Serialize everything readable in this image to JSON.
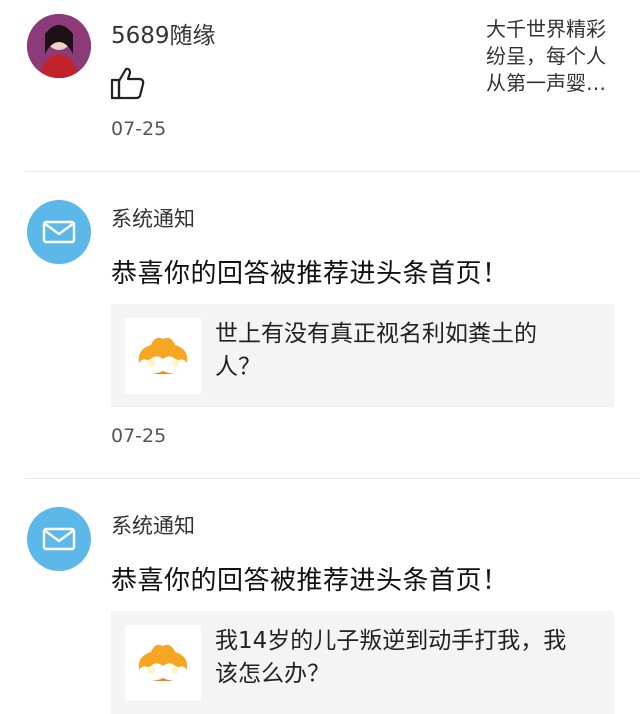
{
  "item1": {
    "username": "5689随缘",
    "snippet_lines": [
      "大千世界精彩",
      "纷呈，每个人",
      "从第一声婴…"
    ],
    "date": "07-25",
    "icon": "thumbs-up-icon"
  },
  "notifications": [
    {
      "title": "系统通知",
      "message": "恭喜你的回答被推荐进头条首页！",
      "card_lines": [
        "世上有没有真正视名利如粪土的",
        "人？"
      ],
      "date": "07-25",
      "icon": "mail-icon"
    },
    {
      "title": "系统通知",
      "message": "恭喜你的回答被推荐进头条首页！",
      "card_lines": [
        "我14岁的儿子叛逆到动手打我，我",
        "该怎么办？"
      ],
      "icon": "mail-icon"
    }
  ],
  "colors": {
    "mail_icon_bg": "#5db8ea",
    "card_bg": "#f4f4f4",
    "badge_orange": "#f5a623"
  }
}
